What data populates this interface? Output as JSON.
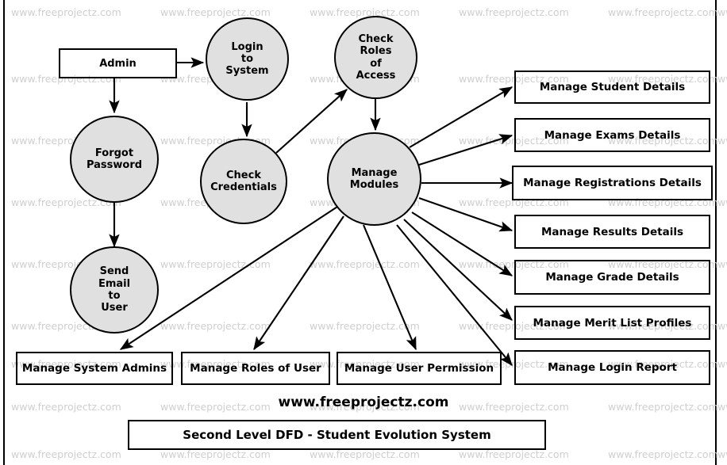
{
  "diagram": {
    "title": "Second Level DFD - Student Evolution System",
    "brand": "www.freeprojectz.com",
    "watermark": "www.freeprojectz.com",
    "colors": {
      "process_fill": "#e0e0e0",
      "stroke": "#000000",
      "watermark": "#cfcfcf",
      "background": "#ffffff"
    }
  },
  "entities": [
    {
      "id": "admin",
      "label": "Admin",
      "shape": "rectangle"
    }
  ],
  "processes": [
    {
      "id": "login",
      "label": "Login\nto\nSystem",
      "lines": [
        "Login",
        "to",
        "System"
      ],
      "shape": "circle"
    },
    {
      "id": "roles",
      "label": "Check\nRoles\nof\nAccess",
      "lines": [
        "Check",
        "Roles",
        "of",
        "Access"
      ],
      "shape": "circle"
    },
    {
      "id": "forgot",
      "label": "Forgot\nPassword",
      "lines": [
        "Forgot",
        "Password"
      ],
      "shape": "circle"
    },
    {
      "id": "credentials",
      "label": "Check\nCredentials",
      "lines": [
        "Check",
        "Credentials"
      ],
      "shape": "circle"
    },
    {
      "id": "sendmail",
      "label": "Send\nEmail\nto\nUser",
      "lines": [
        "Send",
        "Email",
        "to",
        "User"
      ],
      "shape": "circle"
    },
    {
      "id": "modules",
      "label": "Manage\nModules",
      "lines": [
        "Manage",
        "Modules"
      ],
      "shape": "circle"
    }
  ],
  "stores_right": [
    {
      "id": "student",
      "label": "Manage Student Details"
    },
    {
      "id": "exams",
      "label": "Manage Exams Details"
    },
    {
      "id": "registrations",
      "label": "Manage Registrations Details"
    },
    {
      "id": "results",
      "label": "Manage Results Details"
    },
    {
      "id": "grade",
      "label": "Manage Grade Details"
    },
    {
      "id": "merit",
      "label": "Manage Merit List Profiles"
    },
    {
      "id": "loginreport",
      "label": "Manage Login Report"
    }
  ],
  "stores_bottom": [
    {
      "id": "sysadmins",
      "label": "Manage System Admins"
    },
    {
      "id": "rolesofuser",
      "label": "Manage Roles of User"
    },
    {
      "id": "userpermission",
      "label": "Manage User Permission"
    }
  ],
  "flows": [
    {
      "from": "admin",
      "to": "login"
    },
    {
      "from": "admin",
      "to": "forgot"
    },
    {
      "from": "forgot",
      "to": "sendmail"
    },
    {
      "from": "login",
      "to": "credentials"
    },
    {
      "from": "credentials",
      "to": "roles"
    },
    {
      "from": "roles",
      "to": "modules"
    },
    {
      "from": "modules",
      "to": "student"
    },
    {
      "from": "modules",
      "to": "exams"
    },
    {
      "from": "modules",
      "to": "registrations"
    },
    {
      "from": "modules",
      "to": "results"
    },
    {
      "from": "modules",
      "to": "grade"
    },
    {
      "from": "modules",
      "to": "merit"
    },
    {
      "from": "modules",
      "to": "loginreport"
    },
    {
      "from": "modules",
      "to": "sysadmins"
    },
    {
      "from": "modules",
      "to": "rolesofuser"
    },
    {
      "from": "modules",
      "to": "userpermission"
    }
  ],
  "watermark_grid": {
    "columns": [
      14,
      202,
      390,
      578,
      766
    ],
    "rows": [
      8,
      92,
      170,
      248,
      326,
      404,
      452,
      506,
      566
    ]
  }
}
